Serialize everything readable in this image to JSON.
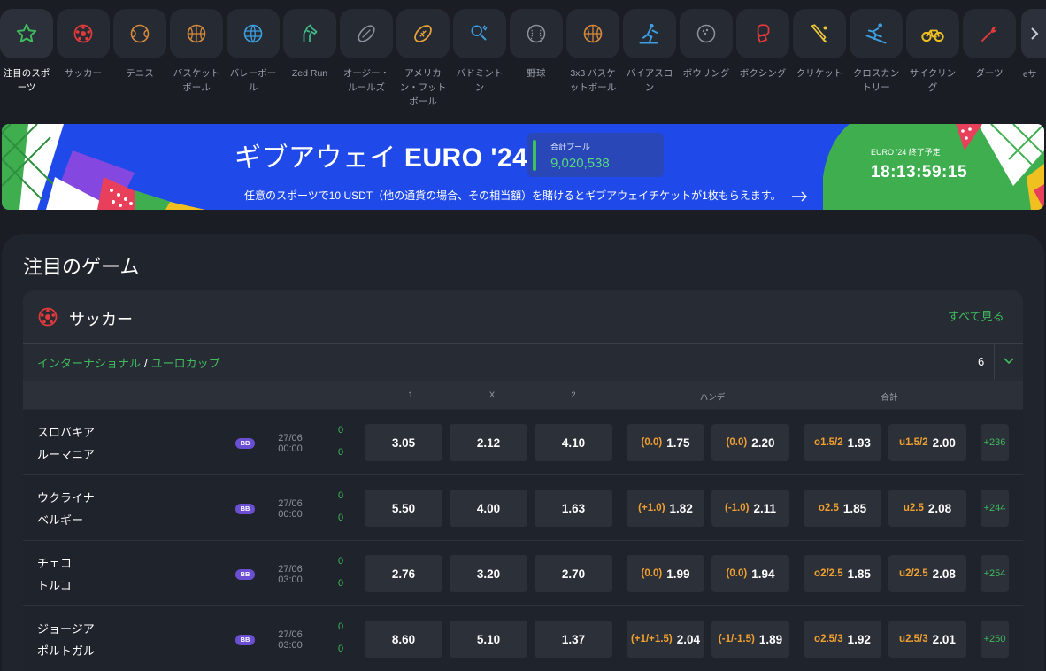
{
  "sports_nav": {
    "items": [
      {
        "label": "注目のスポーツ",
        "icon": "star-icon"
      },
      {
        "label": "サッカー",
        "icon": "soccer-ball-icon"
      },
      {
        "label": "テニス",
        "icon": "tennis-ball-icon"
      },
      {
        "label": "バスケットボール",
        "icon": "basketball-icon"
      },
      {
        "label": "バレーボール",
        "icon": "volleyball-icon"
      },
      {
        "label": "Zed Run",
        "icon": "horse-icon"
      },
      {
        "label": "オージー・ルールズ",
        "icon": "aussie-rules-ball-icon"
      },
      {
        "label": "アメリカン・フットボール",
        "icon": "american-football-icon"
      },
      {
        "label": "バドミントン",
        "icon": "badminton-icon"
      },
      {
        "label": "野球",
        "icon": "baseball-icon"
      },
      {
        "label": "3x3 バスケットボール",
        "icon": "basketball-3x3-icon"
      },
      {
        "label": "バイアスロン",
        "icon": "biathlon-icon"
      },
      {
        "label": "ボウリング",
        "icon": "bowling-ball-icon"
      },
      {
        "label": "ボクシング",
        "icon": "boxing-glove-icon"
      },
      {
        "label": "クリケット",
        "icon": "cricket-bat-icon"
      },
      {
        "label": "クロスカントリー",
        "icon": "skier-icon"
      },
      {
        "label": "サイクリング",
        "icon": "bicycle-icon"
      },
      {
        "label": "ダーツ",
        "icon": "dart-icon"
      }
    ],
    "next_icon": "chevron-right-icon",
    "cut_label": "eサ"
  },
  "banner": {
    "title_prefix": "ギブアウェイ",
    "title_bold": "EURO '24",
    "pool_label": "合計プール",
    "pool_value": "9,020,538",
    "subtitle": "任意のスポーツで10 USDT（他の通貨の場合、その相当額）を賭けるとギブアウェイチケットが1枚もらえます。",
    "arrow_icon": "arrow-right-icon",
    "end_label": "EURO '24 終了予定",
    "countdown": "18:13:59:15",
    "colors": {
      "blue": "#1f49e8",
      "green": "#3fae4f",
      "accent": "#57d87b"
    }
  },
  "featured": {
    "title": "注目のゲーム",
    "section": {
      "sport": "サッカー",
      "see_all": "すべて見る",
      "breadcrumb_region": "インターナショナル",
      "breadcrumb_separator": "/",
      "breadcrumb_league": "ユーロカップ",
      "count": "6",
      "columns": {
        "c1": "1",
        "cx": "X",
        "c2": "2",
        "handicap": "ハンデ",
        "total": "合計"
      },
      "matches": [
        {
          "home": "スロバキア",
          "away": "ルーマニア",
          "badge": "BB",
          "date": "27/06",
          "time": "00:00",
          "score_home": "0",
          "score_away": "0",
          "odd1": "3.05",
          "oddx": "2.12",
          "odd2": "4.10",
          "h1_line": "(0.0)",
          "h1": "1.75",
          "h2_line": "(0.0)",
          "h2": "2.20",
          "o_line": "o1.5/2",
          "o": "1.93",
          "u_line": "u1.5/2",
          "u": "2.00",
          "more": "+236"
        },
        {
          "home": "ウクライナ",
          "away": "ベルギー",
          "badge": "BB",
          "date": "27/06",
          "time": "00:00",
          "score_home": "0",
          "score_away": "0",
          "odd1": "5.50",
          "oddx": "4.00",
          "odd2": "1.63",
          "h1_line": "(+1.0)",
          "h1": "1.82",
          "h2_line": "(-1.0)",
          "h2": "2.11",
          "o_line": "o2.5",
          "o": "1.85",
          "u_line": "u2.5",
          "u": "2.08",
          "more": "+244"
        },
        {
          "home": "チェコ",
          "away": "トルコ",
          "badge": "BB",
          "date": "27/06",
          "time": "03:00",
          "score_home": "0",
          "score_away": "0",
          "odd1": "2.76",
          "oddx": "3.20",
          "odd2": "2.70",
          "h1_line": "(0.0)",
          "h1": "1.99",
          "h2_line": "(0.0)",
          "h2": "1.94",
          "o_line": "o2/2.5",
          "o": "1.85",
          "u_line": "u2/2.5",
          "u": "2.08",
          "more": "+254"
        },
        {
          "home": "ジョージア",
          "away": "ポルトガル",
          "badge": "BB",
          "date": "27/06",
          "time": "03:00",
          "score_home": "0",
          "score_away": "0",
          "odd1": "8.60",
          "oddx": "5.10",
          "odd2": "1.37",
          "h1_line": "(+1/+1.5)",
          "h1": "2.04",
          "h2_line": "(-1/-1.5)",
          "h2": "1.89",
          "o_line": "o2.5/3",
          "o": "1.92",
          "u_line": "u2.5/3",
          "u": "2.01",
          "more": "+250"
        }
      ]
    }
  }
}
